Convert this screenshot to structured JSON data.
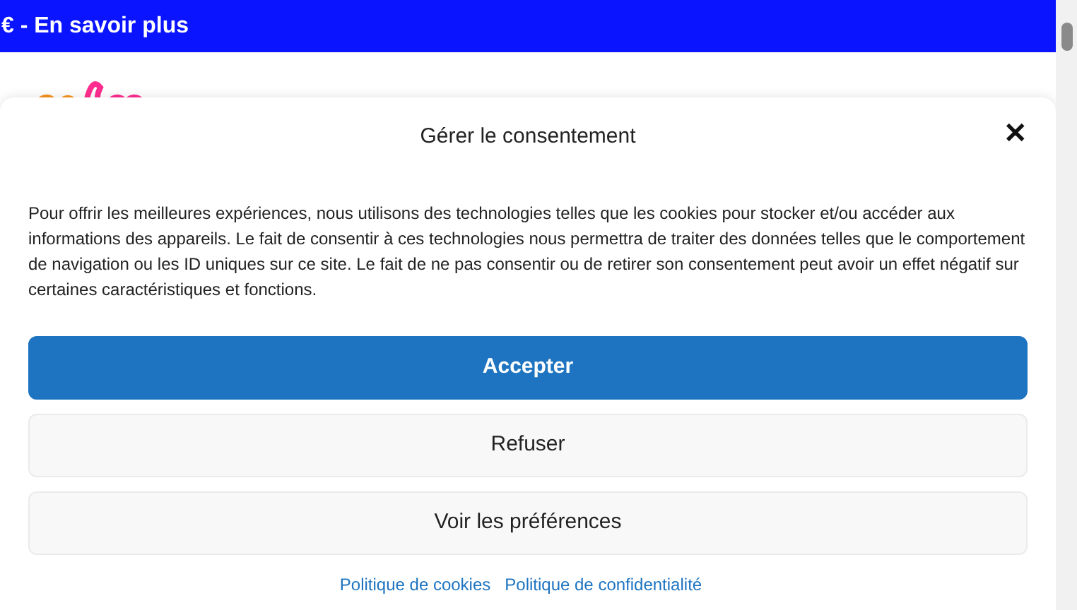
{
  "banner": {
    "text": "€ - En savoir plus"
  },
  "modal": {
    "title": "Gérer le consentement",
    "close": "✕",
    "text": "Pour offrir les meilleures expériences, nous utilisons des technologies telles que les cookies pour stocker et/ou accéder aux informations des appareils. Le fait de consentir à ces technologies nous permettra de traiter des données telles que le comportement de navigation ou les ID uniques sur ce site. Le fait de ne pas consentir ou de retirer son consentement peut avoir un effet négatif sur certaines caractéristiques et fonctions.",
    "buttons": [
      {
        "label": "Accepter",
        "kind": "primary"
      },
      {
        "label": "Refuser",
        "kind": "secondary"
      },
      {
        "label": "Voir les préférences",
        "kind": "secondary"
      }
    ],
    "links": [
      "Politique de cookies",
      "Politique de confidentialité"
    ]
  }
}
